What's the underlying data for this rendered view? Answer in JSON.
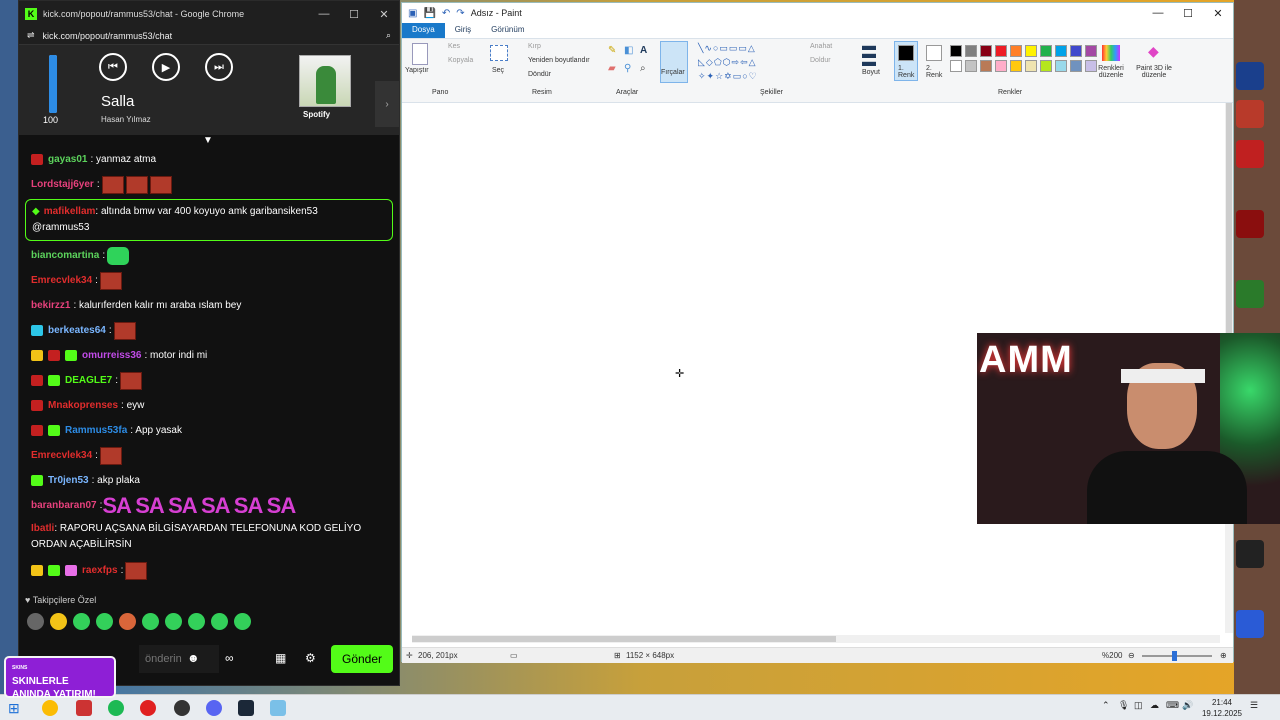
{
  "chrome": {
    "title": "kick.com/popout/rammus53/chat - Google Chrome",
    "url": "kick.com/popout/rammus53/chat"
  },
  "player": {
    "volume": 100,
    "song": "Salla",
    "artist": "Hasan Yılmaz",
    "service": "Spotify"
  },
  "chat": {
    "messages": [
      {
        "user": "gayas01",
        "text": ": yanmaz atma",
        "color": "#5cd35c"
      },
      {
        "user": "Lordstajj6yer",
        "text": ":",
        "color": "#e6417c"
      },
      {
        "user": "Emrecvlek34",
        "text": ":",
        "color": "#e12d2d"
      },
      {
        "user": "bekirzz1",
        "text": ": kalurıferden kalır mı araba ıslam bey",
        "color": "#e6417c"
      },
      {
        "user": "berkeates64",
        "text": ":",
        "color": "#7ab6ff"
      },
      {
        "user": "omurreiss36",
        "text": ": motor indi mi",
        "color": "#c14be8"
      },
      {
        "user": "DEAGLE7",
        "text": ":",
        "color": "#53fc18"
      },
      {
        "user": "Mnakoprenses",
        "text": ": eyw",
        "color": "#e12d2d"
      },
      {
        "user": "Rammus53fa",
        "text": ": App yasak",
        "color": "#2d8ce5"
      },
      {
        "user": "Emrecvlek34",
        "text": ":",
        "color": "#e12d2d"
      },
      {
        "user": "Tr0jen53",
        "text": ": akp plaka",
        "color": "#7ab6ff"
      },
      {
        "user": "baranbaran07",
        "text": ":",
        "color": "#e6417c"
      },
      {
        "user": "raexfps",
        "text": ":",
        "color": "#e12d2d"
      }
    ],
    "highlight": {
      "user": "mafikellam",
      "text": ": altında bmw var 400 koyuyo amk garibansiken53",
      "mention": "@rammus53"
    },
    "bianco": {
      "user": "biancomartina",
      "text": ":"
    },
    "sa_text": "SA SA SA SA SA SA",
    "long": {
      "user": "Ibatli",
      "text": ": RAPORU AÇSANA BİLGİSAYARDAN TELEFONUNA KOD GELİYO ORDAN AÇABİLİRSİN"
    },
    "followers_label": "Takipçilere Özel",
    "input_placeholder": "önderin",
    "send_label": "Gönder",
    "ad_line1": "SKINLERLE",
    "ad_line2": "ANINDA YATIRIM!",
    "ad_small": "SKINS"
  },
  "paint": {
    "title": "Adsız - Paint",
    "tabs": [
      "Dosya",
      "Giriş",
      "Görünüm"
    ],
    "clipboard": {
      "paste": "Yapıştır",
      "cut": "Kes",
      "copy": "Kopyala",
      "group": "Pano"
    },
    "image": {
      "select": "Seç",
      "crop": "Kırp",
      "resize": "Yeniden boyutlandır",
      "rotate": "Döndür",
      "group": "Resim"
    },
    "tools_group": "Araçlar",
    "brushes": "Fırçalar",
    "shapes": {
      "outline": "Anahat",
      "fill": "Doldur",
      "group": "Şekiller"
    },
    "size": "Boyut",
    "color1": "1. Renk",
    "color2": "2. Renk",
    "colors_group": "Renkler",
    "edit_colors": "Renkleri düzenle",
    "paint3d": "Paint 3D ile düzenle",
    "status_pos": "206, 201px",
    "status_size": "1152 × 648px",
    "zoom": "%200",
    "palette": [
      "#000000",
      "#7f7f7f",
      "#880015",
      "#ed1c24",
      "#ff7f27",
      "#fff200",
      "#22b14c",
      "#00a2e8",
      "#3f48cc",
      "#a349a4",
      "#ffffff",
      "#c3c3c3",
      "#b97a57",
      "#ffaec9",
      "#ffc90e",
      "#efe4b0",
      "#b5e61d",
      "#99d9ea",
      "#7092be",
      "#c8bfe7"
    ]
  },
  "webcam": {
    "neon_text": "AMM"
  },
  "taskbar": {
    "time": "21:44",
    "date": "19.12.2025"
  }
}
